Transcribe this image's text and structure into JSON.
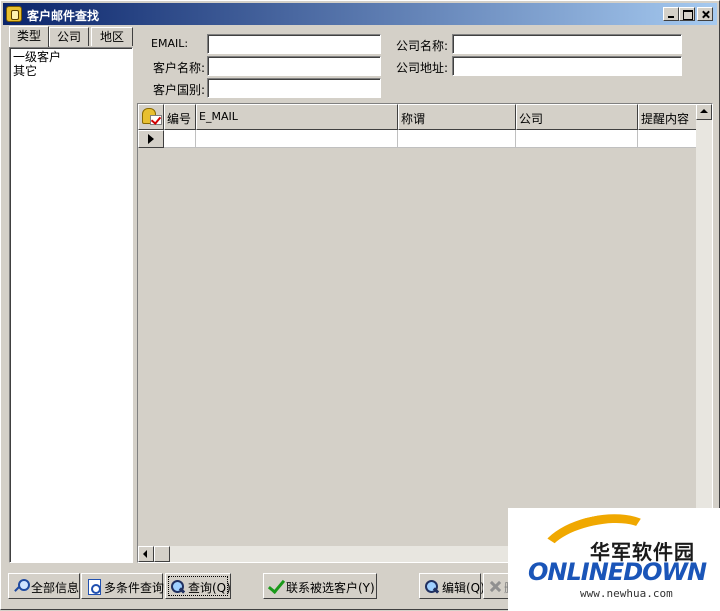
{
  "window": {
    "title": "客户邮件查找",
    "icon": "app-folder-icon"
  },
  "left_panel": {
    "tabs": [
      {
        "label": "类型",
        "active": true
      },
      {
        "label": "公司",
        "active": false
      },
      {
        "label": "地区",
        "active": false
      }
    ],
    "items": [
      "一级客户",
      "其它"
    ]
  },
  "search_form": {
    "email_label": "EMAIL:",
    "customer_name_label": "客户名称:",
    "customer_country_label": "客户国别:",
    "company_name_label": "公司名称:",
    "company_address_label": "公司地址:",
    "email_value": "",
    "customer_name_value": "",
    "customer_country_value": "",
    "company_name_value": "",
    "company_address_value": ""
  },
  "grid": {
    "columns": [
      "编号",
      "E_MAIL",
      "称谓",
      "公司",
      "提醒内容"
    ],
    "rows": [
      [
        "",
        "",
        "",
        "",
        ""
      ]
    ]
  },
  "toolbar": {
    "all_info": "全部信息",
    "multi_query": "多条件查询",
    "query": "查询(Q)",
    "link_selected": "联系被选客户(Y)",
    "edit": "编辑(Q)",
    "delete": "删"
  },
  "watermark": {
    "cn_text": "华军软件园",
    "en_text": "ONLINEDOWN",
    "url": "www.newhua.com",
    "accent_color": "#f0a800",
    "brand_color": "#1a55b8"
  }
}
